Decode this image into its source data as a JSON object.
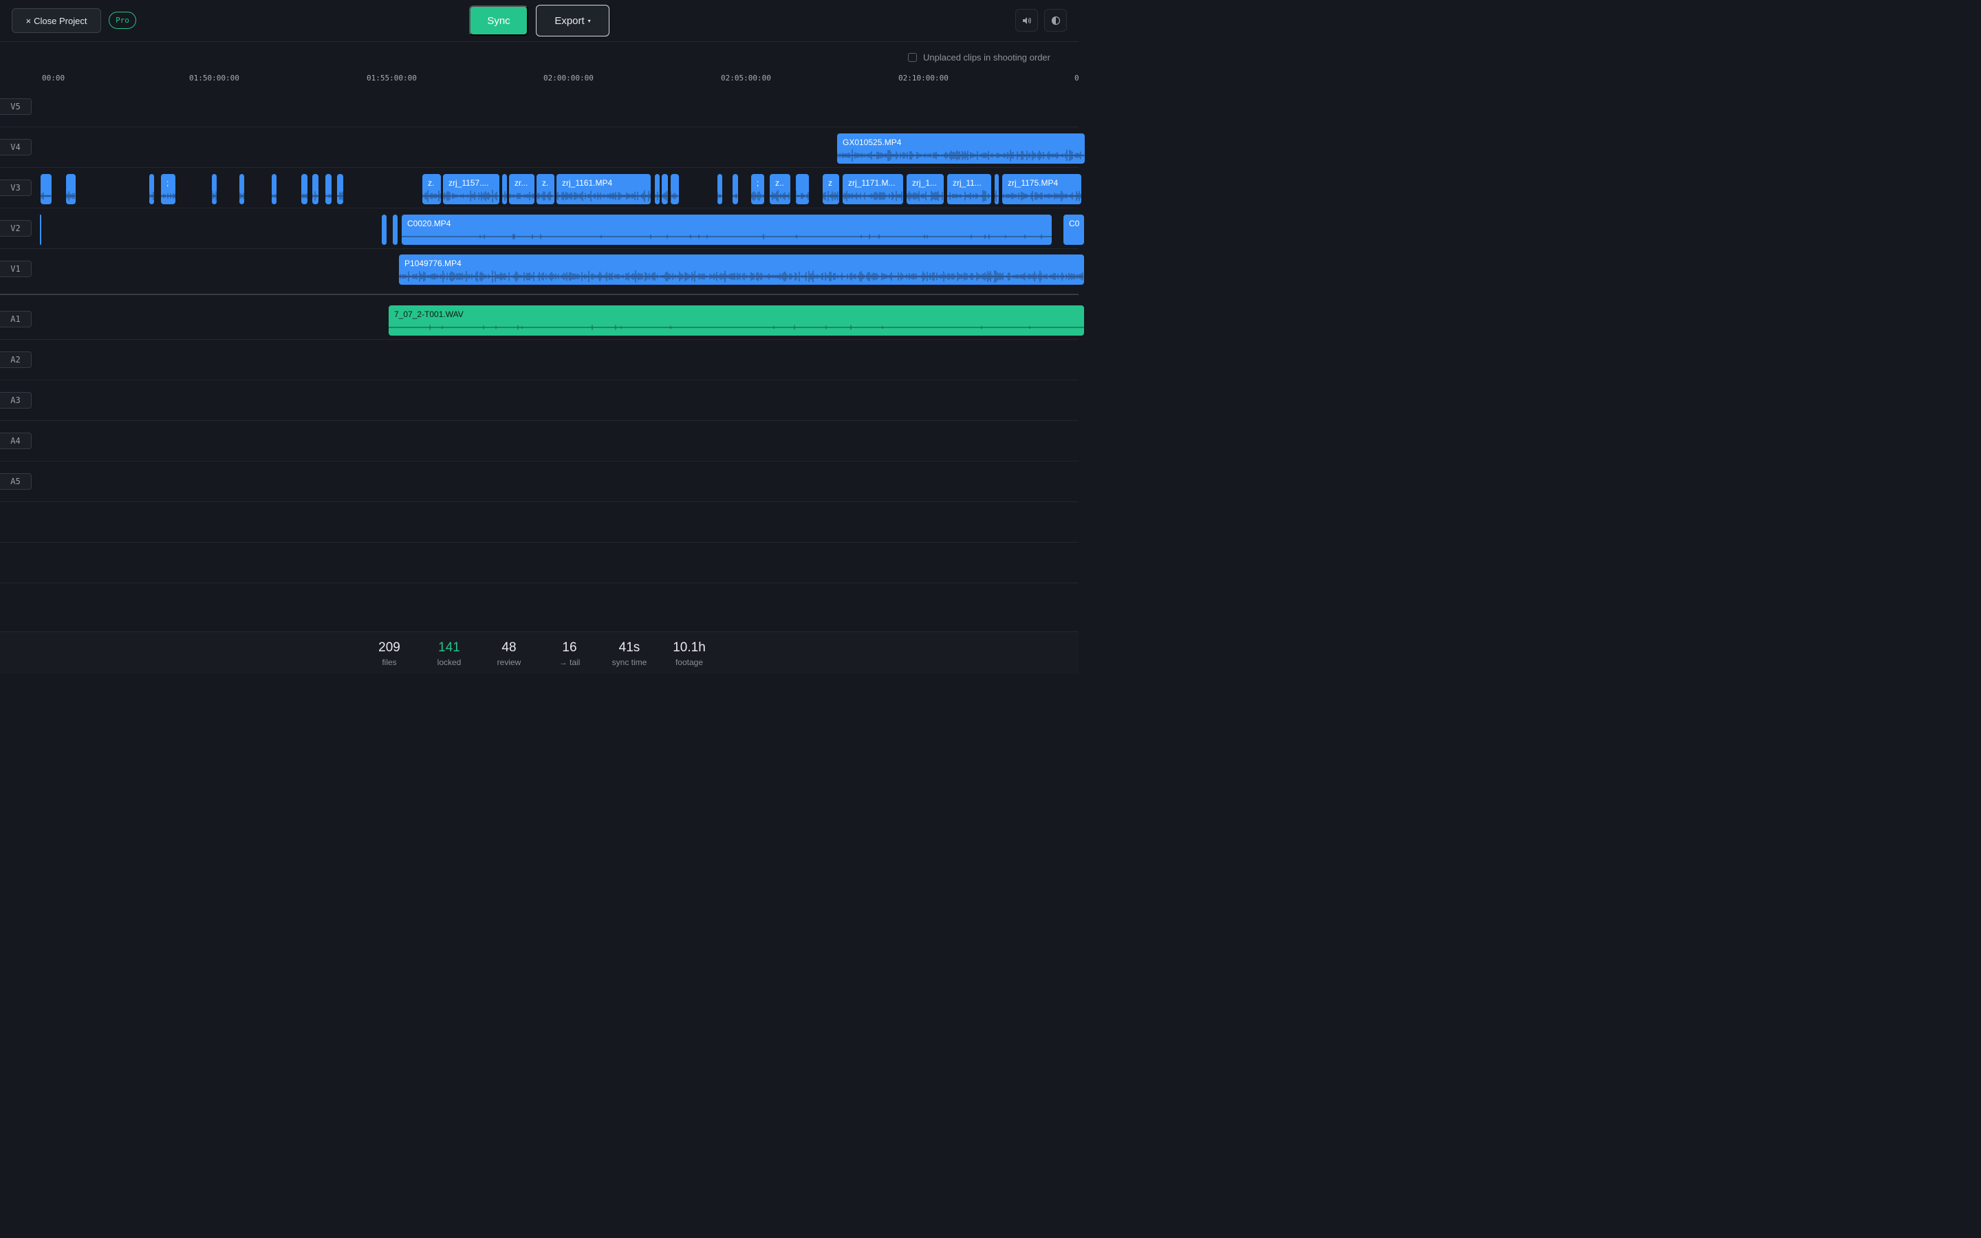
{
  "header": {
    "close_label": "Close Project",
    "close_icon": "×",
    "badge": "Pro",
    "sync_label": "Sync",
    "export_label": "Export",
    "export_caret": "▾",
    "volume_icon": "🔈",
    "theme_icon": "◐"
  },
  "options": {
    "unplaced_label": "Unplaced clips in shooting order",
    "unplaced_checked": false
  },
  "ruler": {
    "ticks": [
      "00:00",
      "01:50:00:00",
      "01:55:00:00",
      "02:00:00:00",
      "02:05:00:00",
      "02:10:00:00",
      "0"
    ]
  },
  "tracks": [
    "V5",
    "V4",
    "V3",
    "V2",
    "V1",
    "A1",
    "A2",
    "A3",
    "A4",
    "A5"
  ],
  "clips": {
    "v4_gx": "GX010525.MP4",
    "v3_a": ";",
    "v3_b": "z.",
    "v3_c": "zrj_1157....",
    "v3_d": "zr...",
    "v3_e": "z.",
    "v3_f": "zrj_1161.MP4",
    "v3_g": ";",
    "v3_h": "z..",
    "v3_i": "z",
    "v3_j": "zrj_1171.M...",
    "v3_k": "zrj_1...",
    "v3_l": "zrj_11...",
    "v3_m": "zrj_1175.MP4",
    "v2_c0020": "C0020.MP4",
    "v2_next": "C0",
    "v1_p": "P1049776.MP4",
    "a1_wav": "7_07_2-T001.WAV"
  },
  "colors": {
    "video": "#3b8ff7",
    "audio": "#25c48c",
    "accent": "#26c28a"
  },
  "stats": [
    {
      "value": "209",
      "label": "files"
    },
    {
      "value": "141",
      "label": "locked"
    },
    {
      "value": "48",
      "label": "review"
    },
    {
      "value": "16",
      "label": "→ tail"
    },
    {
      "value": "41s",
      "label": "sync time"
    },
    {
      "value": "10.1h",
      "label": "footage"
    }
  ]
}
